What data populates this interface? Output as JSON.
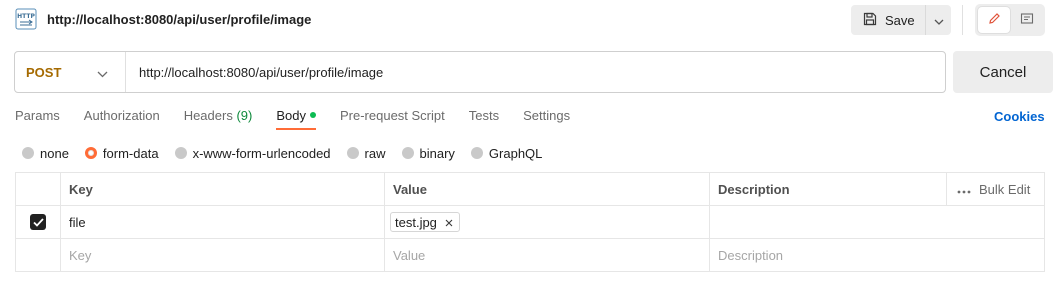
{
  "header": {
    "icon": "http-icon",
    "title": "http://localhost:8080/api/user/profile/image",
    "save_label": "Save",
    "save_icon": "save-icon",
    "caret_icon": "chevron-down-icon",
    "edit_icon": "pencil-icon",
    "doc_icon": "document-icon"
  },
  "request": {
    "method": "POST",
    "method_color": "#a56a00",
    "url": "http://localhost:8080/api/user/profile/image",
    "cancel_label": "Cancel"
  },
  "tabs": [
    {
      "label": "Params"
    },
    {
      "label": "Authorization"
    },
    {
      "label": "Headers",
      "count": "(9)"
    },
    {
      "label": "Body",
      "active": true,
      "dot_color": "#0cbb52"
    },
    {
      "label": "Pre-request Script"
    },
    {
      "label": "Tests"
    },
    {
      "label": "Settings"
    }
  ],
  "cookies_label": "Cookies",
  "body_types": [
    {
      "label": "none"
    },
    {
      "label": "form-data",
      "selected": true
    },
    {
      "label": "x-www-form-urlencoded"
    },
    {
      "label": "raw"
    },
    {
      "label": "binary"
    },
    {
      "label": "GraphQL"
    }
  ],
  "table": {
    "headers": {
      "key": "Key",
      "value": "Value",
      "description": "Description",
      "bulk_edit": "Bulk Edit"
    },
    "rows": [
      {
        "checked": true,
        "key": "file",
        "file_value": "test.jpg",
        "description": ""
      }
    ],
    "placeholder": {
      "key": "Key",
      "value": "Value",
      "description": "Description"
    }
  },
  "colors": {
    "accent": "#ff6c37",
    "link": "#0265d2",
    "status_green": "#0e8a3c"
  }
}
